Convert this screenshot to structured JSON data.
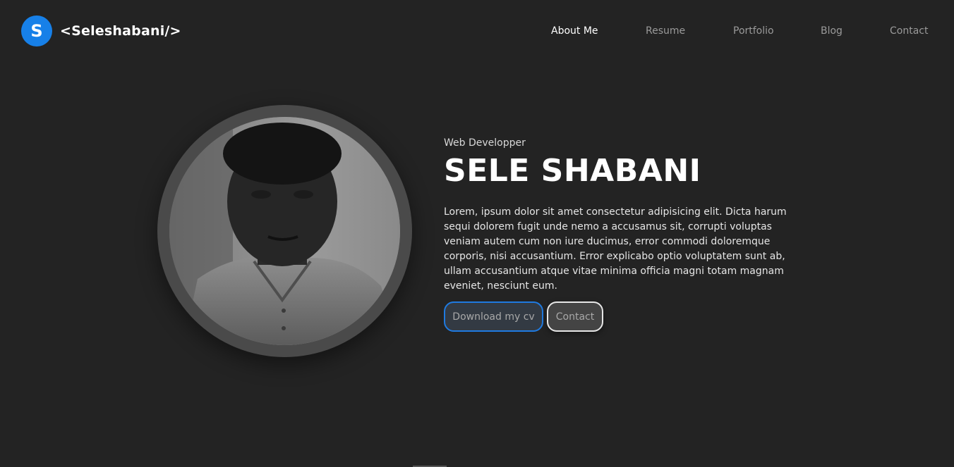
{
  "header": {
    "logo_letter": "S",
    "logo_text": "<Seleshabani/>",
    "brand_color": "#1780e8"
  },
  "nav": {
    "items": [
      {
        "label": "About Me",
        "active": true
      },
      {
        "label": "Resume",
        "active": false
      },
      {
        "label": "Portfolio",
        "active": false
      },
      {
        "label": "Blog",
        "active": false
      },
      {
        "label": "Contact",
        "active": false
      }
    ]
  },
  "hero": {
    "role": "Web Developper",
    "name": "SELE SHABANI",
    "bio": "Lorem, ipsum dolor sit amet consectetur adipisicing elit. Dicta harum sequi dolorem fugit unde nemo a accusamus sit, corrupti voluptas veniam autem cum non iure ducimus, error commodi doloremque corporis, nisi accusantium. Error explicabo optio voluptatem sunt ab, ullam accusantium atque vitae minima officia magni totam magnam eveniet, nesciunt eum.",
    "download_button": "Download my cv",
    "contact_button": "Contact"
  },
  "colors": {
    "background": "#232323",
    "accent": "#1f7ae0"
  }
}
